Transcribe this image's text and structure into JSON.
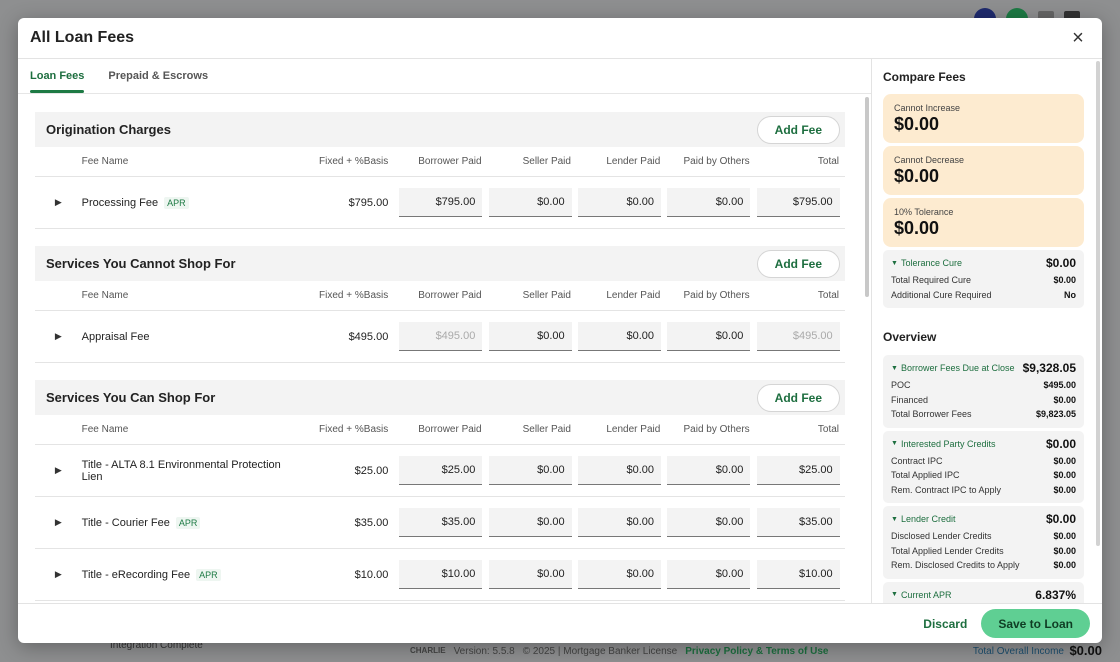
{
  "modal": {
    "title": "All Loan Fees",
    "close_icon": "×"
  },
  "tabs": [
    {
      "label": "Loan Fees",
      "active": true
    },
    {
      "label": "Prepaid & Escrows",
      "active": false
    }
  ],
  "columns": {
    "fee_name": "Fee Name",
    "fixed": "Fixed + %Basis",
    "borrower": "Borrower Paid",
    "seller": "Seller Paid",
    "lender": "Lender Paid",
    "others": "Paid by Others",
    "total": "Total"
  },
  "add_fee_label": "Add Fee",
  "sections": [
    {
      "title": "Origination Charges",
      "rows": [
        {
          "name": "Processing Fee",
          "apr": "APR",
          "fixed": "$795.00",
          "borrower": "$795.00",
          "seller": "$0.00",
          "lender": "$0.00",
          "others": "$0.00",
          "total": "$795.00"
        }
      ]
    },
    {
      "title": "Services You Cannot Shop For",
      "rows": [
        {
          "name": "Appraisal Fee",
          "apr": "",
          "fixed": "$495.00",
          "borrower": "$495.00",
          "seller": "$0.00",
          "lender": "$0.00",
          "others": "$0.00",
          "total": "$495.00"
        }
      ]
    },
    {
      "title": "Services You Can Shop For",
      "rows": [
        {
          "name": "Title - ALTA 8.1 Environmental Protection Lien",
          "apr": "",
          "fixed": "$25.00",
          "borrower": "$25.00",
          "seller": "$0.00",
          "lender": "$0.00",
          "others": "$0.00",
          "total": "$25.00"
        },
        {
          "name": "Title - Courier Fee",
          "apr": "APR",
          "fixed": "$35.00",
          "borrower": "$35.00",
          "seller": "$0.00",
          "lender": "$0.00",
          "others": "$0.00",
          "total": "$35.00"
        },
        {
          "name": "Title - eRecording Fee",
          "apr": "APR",
          "fixed": "$10.00",
          "borrower": "$10.00",
          "seller": "$0.00",
          "lender": "$0.00",
          "others": "$0.00",
          "total": "$10.00"
        }
      ]
    }
  ],
  "compare": {
    "title": "Compare Fees",
    "cannot_increase": {
      "label": "Cannot Increase",
      "value": "$0.00"
    },
    "cannot_decrease": {
      "label": "Cannot Decrease",
      "value": "$0.00"
    },
    "tolerance": {
      "label": "10% Tolerance",
      "value": "$0.00"
    },
    "tolerance_cure": {
      "label": "Tolerance Cure",
      "value": "$0.00",
      "rows": [
        {
          "label": "Total Required Cure",
          "value": "$0.00"
        },
        {
          "label": "Additional Cure Required",
          "value": "No"
        }
      ]
    }
  },
  "overview": {
    "title": "Overview",
    "borrower_fees": {
      "label": "Borrower Fees Due at Close",
      "value": "$9,328.05",
      "rows": [
        {
          "label": "POC",
          "value": "$495.00"
        },
        {
          "label": "Financed",
          "value": "$0.00"
        },
        {
          "label": "Total Borrower Fees",
          "value": "$9,823.05"
        }
      ]
    },
    "ipc": {
      "label": "Interested Party Credits",
      "value": "$0.00",
      "rows": [
        {
          "label": "Contract IPC",
          "value": "$0.00"
        },
        {
          "label": "Total Applied IPC",
          "value": "$0.00"
        },
        {
          "label": "Rem. Contract IPC to Apply",
          "value": "$0.00"
        }
      ]
    },
    "lender_credit": {
      "label": "Lender Credit",
      "value": "$0.00",
      "rows": [
        {
          "label": "Disclosed Lender Credits",
          "value": "$0.00"
        },
        {
          "label": "Total Applied Lender Credits",
          "value": "$0.00"
        },
        {
          "label": "Rem. Disclosed Credits to Apply",
          "value": "$0.00"
        }
      ]
    },
    "apr": {
      "label": "Current APR",
      "value": "6.837%"
    }
  },
  "footer": {
    "discard": "Discard",
    "save": "Save to Loan"
  },
  "background": {
    "integration": "Integration Complete",
    "brand": "CHARLIE",
    "version": "Version: 5.5.8",
    "copyright": "© 2025 | Mortgage Banker License",
    "links": "Privacy Policy & Terms of Use",
    "total_overall_income": "Total Overall Income",
    "total_overall_income_value": "$0.00"
  }
}
